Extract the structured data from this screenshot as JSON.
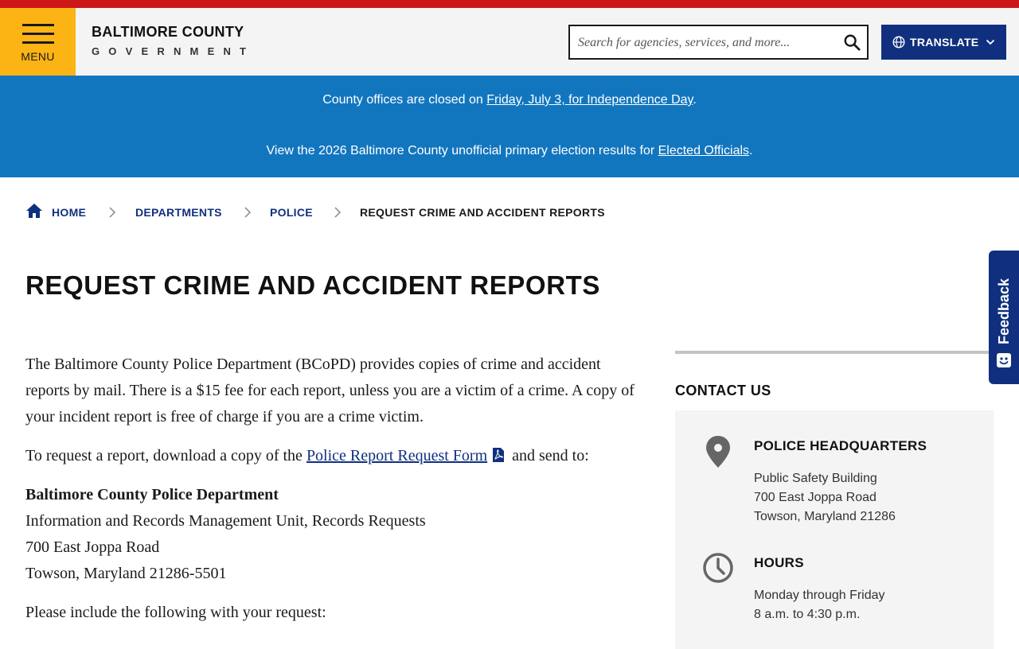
{
  "header": {
    "menu_label": "MENU",
    "logo_line1": "BALTIMORE COUNTY",
    "logo_line2": "GOVERNMENT",
    "search_placeholder": "Search for agencies, services, and more...",
    "translate_label": "TRANSLATE"
  },
  "alerts": {
    "a1_prefix": "County offices are closed on ",
    "a1_link": "Friday, July 3, for Independence Day",
    "a1_suffix": ".",
    "a2_prefix": "View the 2026 Baltimore County unofficial primary election results for ",
    "a2_link": "Elected Officials",
    "a2_suffix": "."
  },
  "breadcrumb": {
    "home": "HOME",
    "departments": "DEPARTMENTS",
    "police": "POLICE",
    "current": "REQUEST CRIME AND ACCIDENT REPORTS"
  },
  "page": {
    "title": "REQUEST CRIME AND ACCIDENT REPORTS",
    "intro": "The Baltimore County Police Department (BCoPD) provides copies of crime and accident reports by mail. There is a $15 fee for each report, unless you are a victim of a crime. A copy of your incident report is free of charge if you are a crime victim.",
    "request_prefix": "To request a report, download a copy of the ",
    "request_link": "Police Report Request Form",
    "request_suffix": " and send to:",
    "address": {
      "name": "Baltimore County Police Department",
      "line1": "Information and Records Management Unit, Records Requests",
      "line2": "700 East Joppa Road",
      "line3": "Towson, Maryland 21286-5501"
    },
    "include_text": "Please include the following with your request:"
  },
  "sidebar": {
    "heading": "CONTACT US",
    "hq_title": "POLICE HEADQUARTERS",
    "hq_line1": "Public Safety Building",
    "hq_line2": "700 East Joppa Road",
    "hq_line3": "Towson, Maryland 21286",
    "hours_title": "HOURS",
    "hours_line1": "Monday through Friday",
    "hours_line2": "8 a.m. to 4:30 p.m."
  },
  "feedback": {
    "label": "Feedback"
  },
  "colors": {
    "top_stripe": "#cc1818",
    "menu_yellow": "#fcb415",
    "navy": "#10307f",
    "alert_blue": "#1276bf"
  },
  "icons": [
    "hamburger-icon",
    "search-icon",
    "globe-icon",
    "chevron-down-icon",
    "home-icon",
    "chevron-right-icon",
    "pdf-icon",
    "map-pin-icon",
    "clock-icon",
    "feedback-icon"
  ]
}
